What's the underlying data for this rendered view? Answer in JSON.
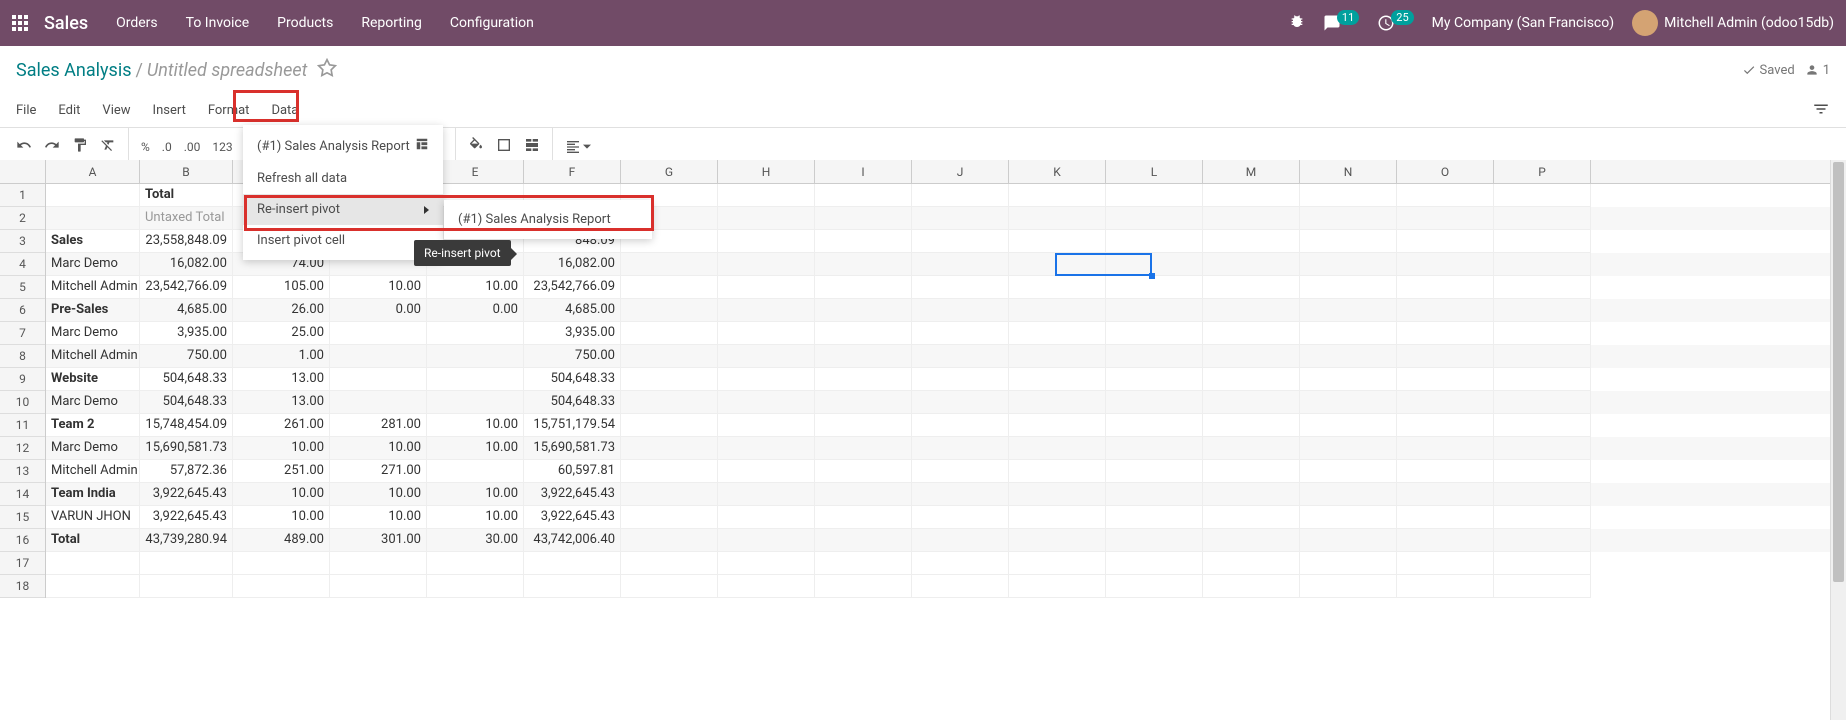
{
  "topbar": {
    "brand": "Sales",
    "menu": [
      "Orders",
      "To Invoice",
      "Products",
      "Reporting",
      "Configuration"
    ],
    "msg_count": "11",
    "act_count": "25",
    "company": "My Company (San Francisco)",
    "user": "Mitchell Admin (odoo15db)"
  },
  "breadcrumb": {
    "main": "Sales Analysis",
    "sub": "Untitled spreadsheet",
    "saved": "Saved",
    "users": "1"
  },
  "menubar": [
    "File",
    "Edit",
    "View",
    "Insert",
    "Format",
    "Data"
  ],
  "toolbar": {
    "percent": "%",
    "dec0": ".0",
    "dec00": ".00",
    "num123": "123"
  },
  "dropdown": {
    "item0": "(#1) Sales Analysis Report",
    "item1": "Refresh all data",
    "item2": "Re-insert pivot",
    "item3": "Insert pivot cell",
    "submenu0": "(#1) Sales Analysis Report",
    "tooltip": "Re-insert pivot"
  },
  "cols": [
    "A",
    "B",
    "C",
    "D",
    "E",
    "F",
    "G",
    "H",
    "I",
    "J",
    "K",
    "L",
    "M",
    "N",
    "O",
    "P"
  ],
  "col_w": {
    "A": 94,
    "B": 93,
    "OTHER": 97
  },
  "rows": [
    {
      "n": "1",
      "shade": false,
      "cells": [
        {
          "t": ""
        },
        {
          "t": "Total",
          "bold": true
        }
      ]
    },
    {
      "n": "2",
      "shade": true,
      "cells": [
        {
          "t": ""
        },
        {
          "t": "Untaxed Total",
          "grey": true
        }
      ]
    },
    {
      "n": "3",
      "shade": false,
      "cells": [
        {
          "t": "Sales",
          "bold": true
        },
        {
          "t": "23,558,848.09",
          "num": true
        },
        {
          "t": ""
        },
        {
          "t": ""
        },
        {
          "t": ""
        },
        {
          "t": "848.09",
          "num": true
        }
      ]
    },
    {
      "n": "4",
      "shade": true,
      "cells": [
        {
          "t": "Marc Demo"
        },
        {
          "t": "16,082.00",
          "num": true
        },
        {
          "t": "74.00",
          "num": true
        },
        {
          "t": ""
        },
        {
          "t": ""
        },
        {
          "t": "16,082.00",
          "num": true
        }
      ]
    },
    {
      "n": "5",
      "shade": false,
      "cells": [
        {
          "t": "Mitchell Admin"
        },
        {
          "t": "23,542,766.09",
          "num": true
        },
        {
          "t": "105.00",
          "num": true
        },
        {
          "t": "10.00",
          "num": true
        },
        {
          "t": "10.00",
          "num": true
        },
        {
          "t": "23,542,766.09",
          "num": true
        }
      ]
    },
    {
      "n": "6",
      "shade": true,
      "cells": [
        {
          "t": "Pre-Sales",
          "bold": true
        },
        {
          "t": "4,685.00",
          "num": true
        },
        {
          "t": "26.00",
          "num": true
        },
        {
          "t": "0.00",
          "num": true
        },
        {
          "t": "0.00",
          "num": true
        },
        {
          "t": "4,685.00",
          "num": true
        }
      ]
    },
    {
      "n": "7",
      "shade": false,
      "cells": [
        {
          "t": "Marc Demo"
        },
        {
          "t": "3,935.00",
          "num": true
        },
        {
          "t": "25.00",
          "num": true
        },
        {
          "t": ""
        },
        {
          "t": ""
        },
        {
          "t": "3,935.00",
          "num": true
        }
      ]
    },
    {
      "n": "8",
      "shade": true,
      "cells": [
        {
          "t": "Mitchell Admin"
        },
        {
          "t": "750.00",
          "num": true
        },
        {
          "t": "1.00",
          "num": true
        },
        {
          "t": ""
        },
        {
          "t": ""
        },
        {
          "t": "750.00",
          "num": true
        }
      ]
    },
    {
      "n": "9",
      "shade": false,
      "cells": [
        {
          "t": "Website",
          "bold": true
        },
        {
          "t": "504,648.33",
          "num": true
        },
        {
          "t": "13.00",
          "num": true
        },
        {
          "t": ""
        },
        {
          "t": ""
        },
        {
          "t": "504,648.33",
          "num": true
        }
      ]
    },
    {
      "n": "10",
      "shade": true,
      "cells": [
        {
          "t": "Marc Demo"
        },
        {
          "t": "504,648.33",
          "num": true
        },
        {
          "t": "13.00",
          "num": true
        },
        {
          "t": ""
        },
        {
          "t": ""
        },
        {
          "t": "504,648.33",
          "num": true
        }
      ]
    },
    {
      "n": "11",
      "shade": false,
      "cells": [
        {
          "t": "Team 2",
          "bold": true
        },
        {
          "t": "15,748,454.09",
          "num": true
        },
        {
          "t": "261.00",
          "num": true
        },
        {
          "t": "281.00",
          "num": true
        },
        {
          "t": "10.00",
          "num": true
        },
        {
          "t": "15,751,179.54",
          "num": true
        }
      ]
    },
    {
      "n": "12",
      "shade": true,
      "cells": [
        {
          "t": "Marc Demo"
        },
        {
          "t": "15,690,581.73",
          "num": true
        },
        {
          "t": "10.00",
          "num": true
        },
        {
          "t": "10.00",
          "num": true
        },
        {
          "t": "10.00",
          "num": true
        },
        {
          "t": "15,690,581.73",
          "num": true
        }
      ]
    },
    {
      "n": "13",
      "shade": false,
      "cells": [
        {
          "t": "Mitchell Admin"
        },
        {
          "t": "57,872.36",
          "num": true
        },
        {
          "t": "251.00",
          "num": true
        },
        {
          "t": "271.00",
          "num": true
        },
        {
          "t": ""
        },
        {
          "t": "60,597.81",
          "num": true
        }
      ]
    },
    {
      "n": "14",
      "shade": true,
      "cells": [
        {
          "t": "Team India",
          "bold": true
        },
        {
          "t": "3,922,645.43",
          "num": true
        },
        {
          "t": "10.00",
          "num": true
        },
        {
          "t": "10.00",
          "num": true
        },
        {
          "t": "10.00",
          "num": true
        },
        {
          "t": "3,922,645.43",
          "num": true
        }
      ]
    },
    {
      "n": "15",
      "shade": false,
      "cells": [
        {
          "t": "VARUN JHON"
        },
        {
          "t": "3,922,645.43",
          "num": true
        },
        {
          "t": "10.00",
          "num": true
        },
        {
          "t": "10.00",
          "num": true
        },
        {
          "t": "10.00",
          "num": true
        },
        {
          "t": "3,922,645.43",
          "num": true
        }
      ]
    },
    {
      "n": "16",
      "shade": true,
      "cells": [
        {
          "t": "Total",
          "bold": true
        },
        {
          "t": "43,739,280.94",
          "num": true
        },
        {
          "t": "489.00",
          "num": true
        },
        {
          "t": "301.00",
          "num": true
        },
        {
          "t": "30.00",
          "num": true
        },
        {
          "t": "43,742,006.40",
          "num": true
        }
      ]
    },
    {
      "n": "17",
      "shade": false,
      "cells": []
    },
    {
      "n": "18",
      "shade": false,
      "cells": []
    }
  ]
}
